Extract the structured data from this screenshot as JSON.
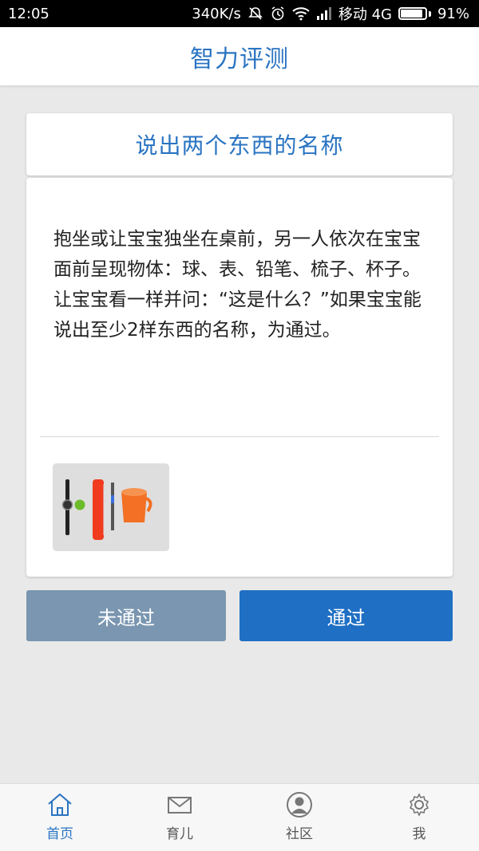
{
  "status_bar": {
    "time": "12:05",
    "speed": "340K/s",
    "carrier": "移动 4G",
    "battery_percent": "91%",
    "battery_level": 0.91
  },
  "header": {
    "title": "智力评测"
  },
  "test": {
    "title": "说出两个东西的名称",
    "description": "抱坐或让宝宝独坐在桌前，另一人依次在宝宝面前呈现物体：球、表、铅笔、梳子、杯子。让宝宝看一样并问：“这是什么？”如果宝宝能说出至少2样东西的名称，为通过。",
    "image_icon": "objects-photo"
  },
  "buttons": {
    "fail_label": "未通过",
    "pass_label": "通过"
  },
  "nav": {
    "items": [
      {
        "label": "首页",
        "icon": "home-icon",
        "active": true
      },
      {
        "label": "育儿",
        "icon": "envelope-icon",
        "active": false
      },
      {
        "label": "社区",
        "icon": "person-icon",
        "active": false
      },
      {
        "label": "我",
        "icon": "gear-icon",
        "active": false
      }
    ]
  },
  "colors": {
    "accent": "#2a74c2",
    "pass_button": "#1f6fc4",
    "fail_button": "#7a96b0"
  }
}
